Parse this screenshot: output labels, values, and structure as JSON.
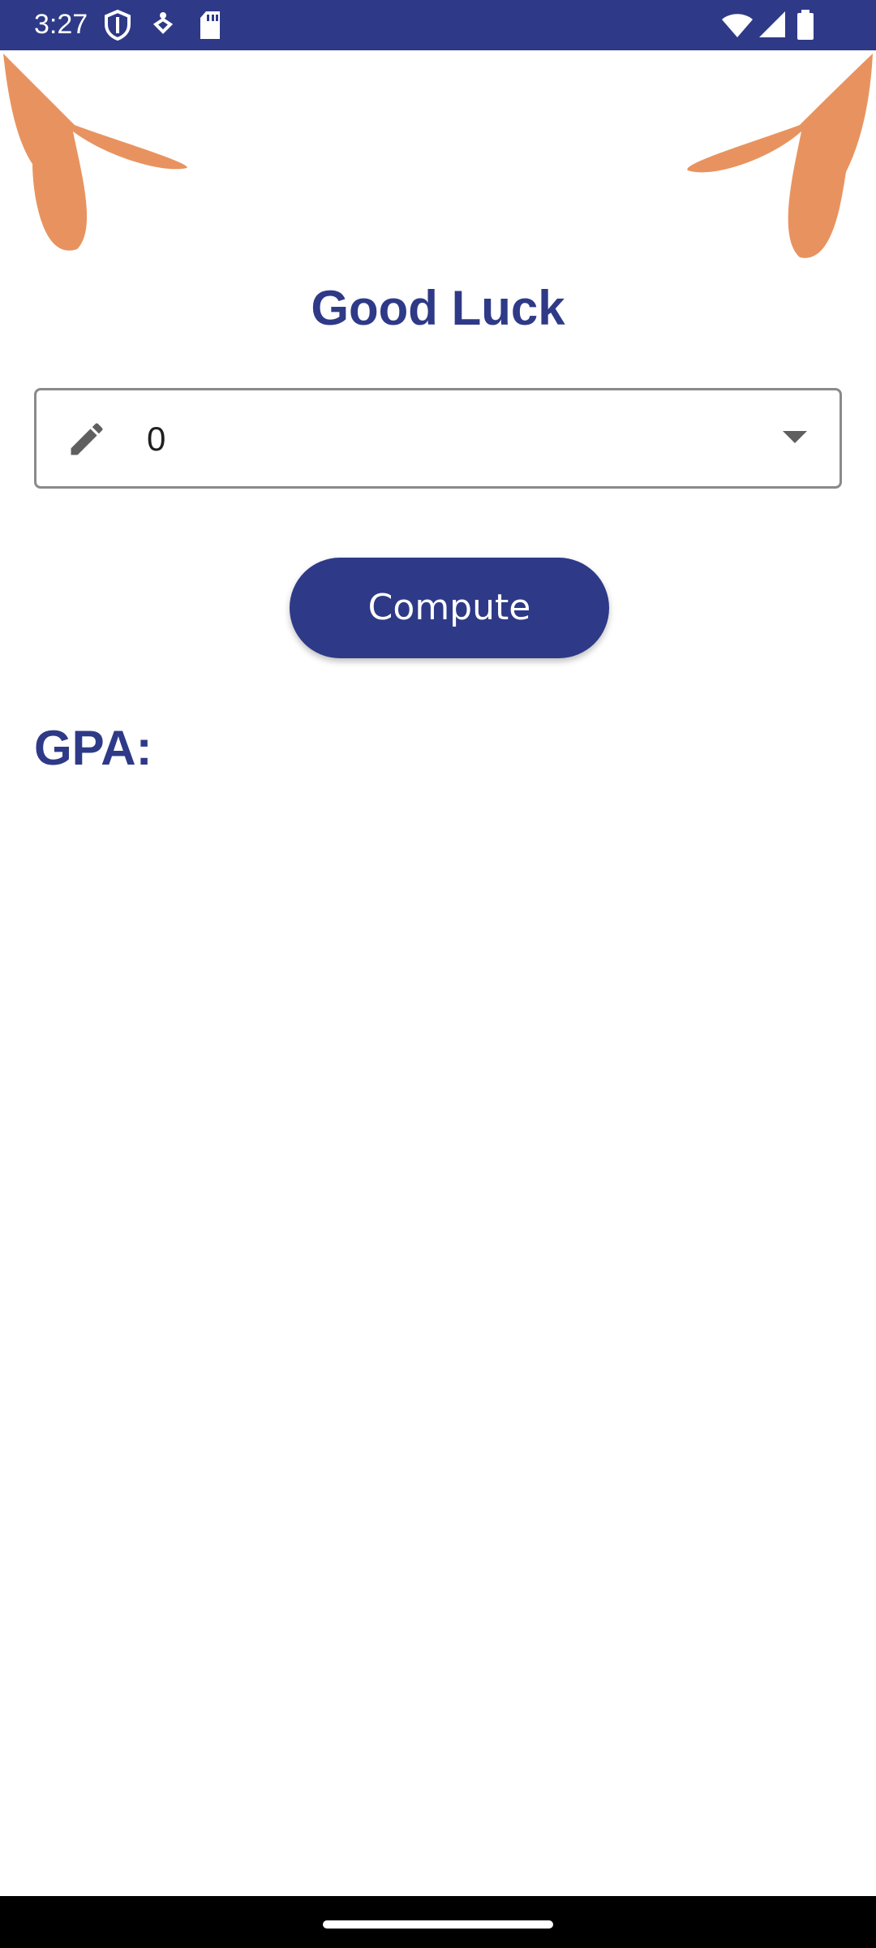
{
  "status_bar": {
    "time": "3:27",
    "background": "#2e3a87",
    "icons": [
      "shield-icon",
      "accessibility-icon",
      "sd-card-icon",
      "wifi-icon",
      "signal-icon",
      "battery-icon"
    ]
  },
  "decorations": {
    "color": "#e8935f",
    "icons": [
      "left-petal-decoration",
      "right-petal-decoration"
    ]
  },
  "main": {
    "title": "Good Luck",
    "field": {
      "value": "0",
      "icon": "pencil-icon",
      "arrow_icon": "dropdown-arrow-icon"
    },
    "compute_label": "Compute",
    "gpa_label": "GPA:",
    "accent_color": "#2e3a87"
  }
}
